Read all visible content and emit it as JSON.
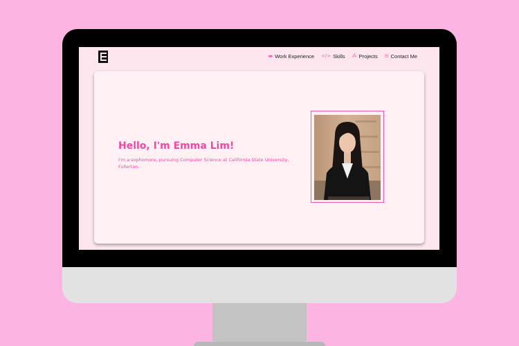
{
  "logo": {
    "icon": "e-monogram-logo"
  },
  "nav": {
    "items": [
      {
        "label": "Work Experience",
        "icon": "briefcase-icon",
        "glyph": "▬"
      },
      {
        "label": "Skills",
        "icon": "code-icon",
        "glyph": "</>"
      },
      {
        "label": "Projects",
        "icon": "project-nodes-icon",
        "glyph": "⁂"
      },
      {
        "label": "Contact Me",
        "icon": "envelope-icon",
        "glyph": "✉"
      }
    ]
  },
  "hero": {
    "heading": "Hello, I'm Emma Lim!",
    "subtext": "I'm a sophomore, pursuing Computer Science at California State University, Fullerton."
  },
  "colors": {
    "background": "#fcb4e3",
    "accent": "#ee4aa2",
    "card": "#fff0f4",
    "screen": "#fde6ee"
  }
}
